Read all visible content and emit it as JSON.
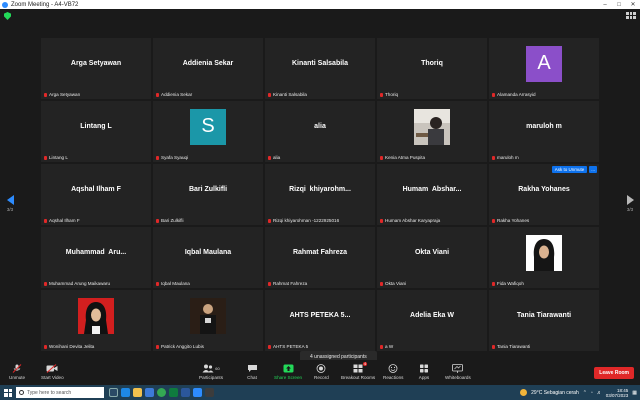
{
  "window": {
    "title": "Zoom Meeting - A4-VB72"
  },
  "pager": {
    "left_page": "3/3",
    "right_page": "3/3"
  },
  "tiles": [
    {
      "display": "Arga Setyawan",
      "tag": "Arga Setyawan"
    },
    {
      "display": "Addienia Sekar",
      "tag": "Addienia Sekar"
    },
    {
      "display": "Kinanti Salsabila",
      "tag": "Kinanti Salsabila"
    },
    {
      "display": "Thoriq",
      "tag": "Thoriq"
    },
    {
      "avatar": "A",
      "avatar_color": "#8b4fc9",
      "tag": "Alamanda Arrasyid"
    },
    {
      "display": "Lintang L",
      "tag": "Lintang L"
    },
    {
      "avatar": "S",
      "avatar_color": "#1b97a8",
      "tag": "Syafa Syauqi"
    },
    {
      "display": "alia",
      "tag": "alia"
    },
    {
      "photo": "photo-desk",
      "tag": "Kenia Atma Puspita"
    },
    {
      "display": "maruloh m",
      "tag": "maruloh m"
    },
    {
      "display": "Aqshal Ilham F",
      "tag": "Aqshal Ilham F"
    },
    {
      "display": "Bari Zulkifli",
      "tag": "Bari Zulkifli"
    },
    {
      "display": "Rizqi  khiyarohm...",
      "tag": "Rizqi khiyarohman -1222925016"
    },
    {
      "display": "Humam  Abshar...",
      "tag": "Humam Abshar Karyapraja"
    },
    {
      "display": "Rakha Yohanes",
      "tag": "Rakha Yohanes",
      "buttons": [
        "Ask to Unmute",
        "..."
      ]
    },
    {
      "display": "Muhammad  Aru...",
      "tag": "Muhammad Arung Maikawaru"
    },
    {
      "display": "Iqbal Maulana",
      "tag": "Iqbal Maulana"
    },
    {
      "display": "Rahmat Fahreza",
      "tag": "Rahmat Fahreza"
    },
    {
      "display": "Okta Viani",
      "tag": "Okta Viani"
    },
    {
      "photo": "photo-hijab-white",
      "tag": "Fida Wafiqoh"
    },
    {
      "photo": "photo-hijab-red",
      "tag": "Wonihani Devita Jelita"
    },
    {
      "photo": "photo-dark",
      "tag": "Patrick Anggito Lubis"
    },
    {
      "display": "AHTS PETEKA 5...",
      "tag": "AHTS PETEKA 5"
    },
    {
      "display": "Adelia Eka W",
      "tag": "a W"
    },
    {
      "display": "Tania Tiarawanti",
      "tag": "Tania Tiarawanti"
    }
  ],
  "toast": "4 unassigned participants",
  "toolbar": {
    "unmute": "Unmute",
    "start_video": "Start Video",
    "participants": "Participants",
    "participants_count": "60",
    "chat": "Chat",
    "share_screen": "Share Screen",
    "record": "Record",
    "breakout_rooms": "Breakout Rooms",
    "breakout_badge": "4",
    "reactions": "Reactions",
    "apps": "Apps",
    "whiteboards": "Whiteboards",
    "leave": "Leave Room"
  },
  "taskbar": {
    "search_placeholder": "Type here to search",
    "weather": "29°C  Sebagian cerah",
    "time": "18:45",
    "date": "03/07/2023"
  }
}
